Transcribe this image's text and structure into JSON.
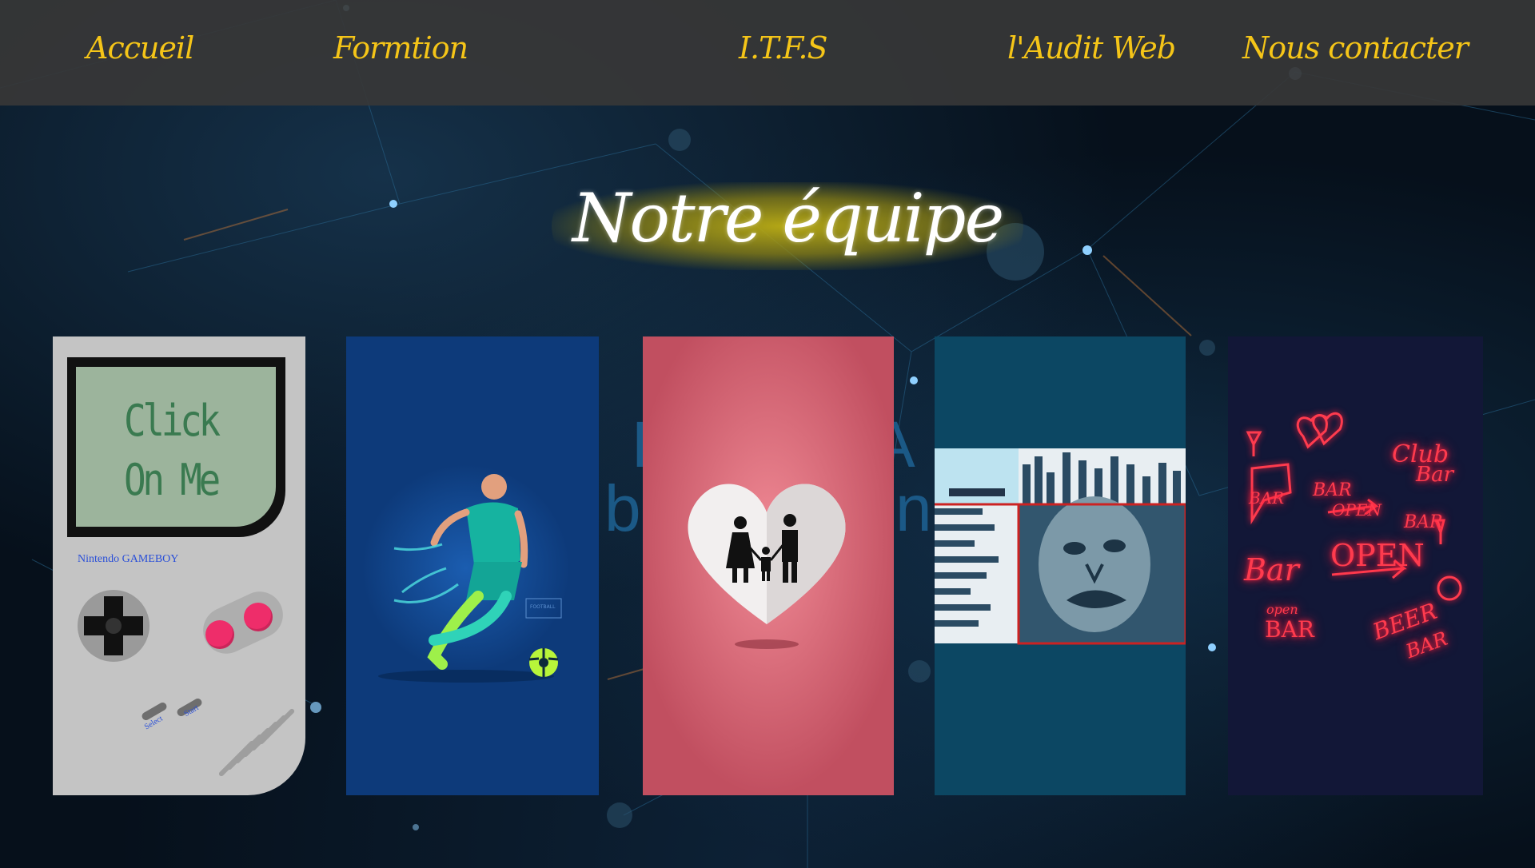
{
  "nav": {
    "items": [
      {
        "label": "Accueil"
      },
      {
        "label": "Formtion"
      },
      {
        "label": "I.T.F.S"
      },
      {
        "label": "l'Audit Web"
      },
      {
        "label": "Nous contacter"
      }
    ]
  },
  "hero": {
    "title": "Notre équipe",
    "bg_text_line1": "B",
    "bg_text_line1_end": "A",
    "bg_text_line2": "b",
    "bg_text_line2_end": "nd"
  },
  "cards": {
    "gameboy": {
      "screen_line1": "Click",
      "screen_line2": "On Me",
      "brand": "Nintendo GAMEBOY",
      "select_label": "Select",
      "start_label": "Start"
    },
    "football": {
      "badge": "FOOTBALL"
    },
    "neon": {
      "signs": [
        "BAR",
        "BAR",
        "OPEN",
        "Club",
        "Bar",
        "BAR",
        "Bar",
        "OPEN",
        "open",
        "BAR",
        "BEER",
        "BAR"
      ]
    }
  },
  "colors": {
    "nav_text": "#f5c518",
    "title_glow": "#b6aa1a",
    "gameboy_body": "#c4c4c4",
    "gameboy_screen": "#9cb49c",
    "gameboy_button": "#ee2d6a",
    "football_bg": "#0d3a7a",
    "family_bg": "#c14f60",
    "nonogram_bg": "#0c4763",
    "neon_bg": "#121737",
    "neon_red": "#ff3b4e"
  }
}
